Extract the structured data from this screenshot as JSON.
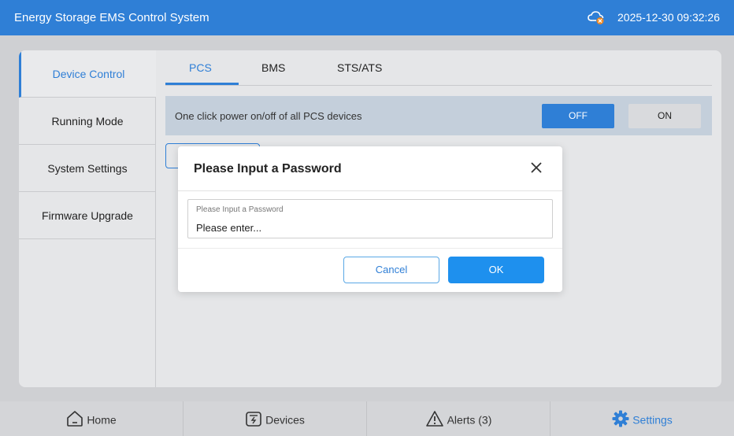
{
  "header": {
    "title": "Energy Storage EMS Control System",
    "cloud_icon": "cloud-disconnected-icon",
    "datetime": "2025-12-30 09:32:26"
  },
  "sidebar": {
    "items": [
      {
        "label": "Device Control",
        "active": true
      },
      {
        "label": "Running Mode",
        "active": false
      },
      {
        "label": "System Settings",
        "active": false
      },
      {
        "label": "Firmware Upgrade",
        "active": false
      }
    ]
  },
  "tabs": [
    {
      "label": "PCS",
      "active": true
    },
    {
      "label": "BMS",
      "active": false
    },
    {
      "label": "STS/ATS",
      "active": false
    }
  ],
  "power": {
    "label": "One click power on/off of all PCS devices",
    "off_label": "OFF",
    "on_label": "ON",
    "selected": "OFF"
  },
  "modal": {
    "title": "Please Input a Password",
    "field_label": "Please Input a Password",
    "field_placeholder": "Please enter...",
    "field_value": "",
    "cancel_label": "Cancel",
    "ok_label": "OK"
  },
  "bottom_nav": [
    {
      "label": "Home",
      "icon": "home-icon",
      "active": false
    },
    {
      "label": "Devices",
      "icon": "devices-icon",
      "active": false
    },
    {
      "label": "Alerts (3)",
      "icon": "alert-icon",
      "active": false
    },
    {
      "label": "Settings",
      "icon": "gear-icon",
      "active": true
    }
  ],
  "colors": {
    "primary": "#2f7fd6",
    "ok_button": "#1e90ee",
    "header": "#2f7fd6"
  }
}
